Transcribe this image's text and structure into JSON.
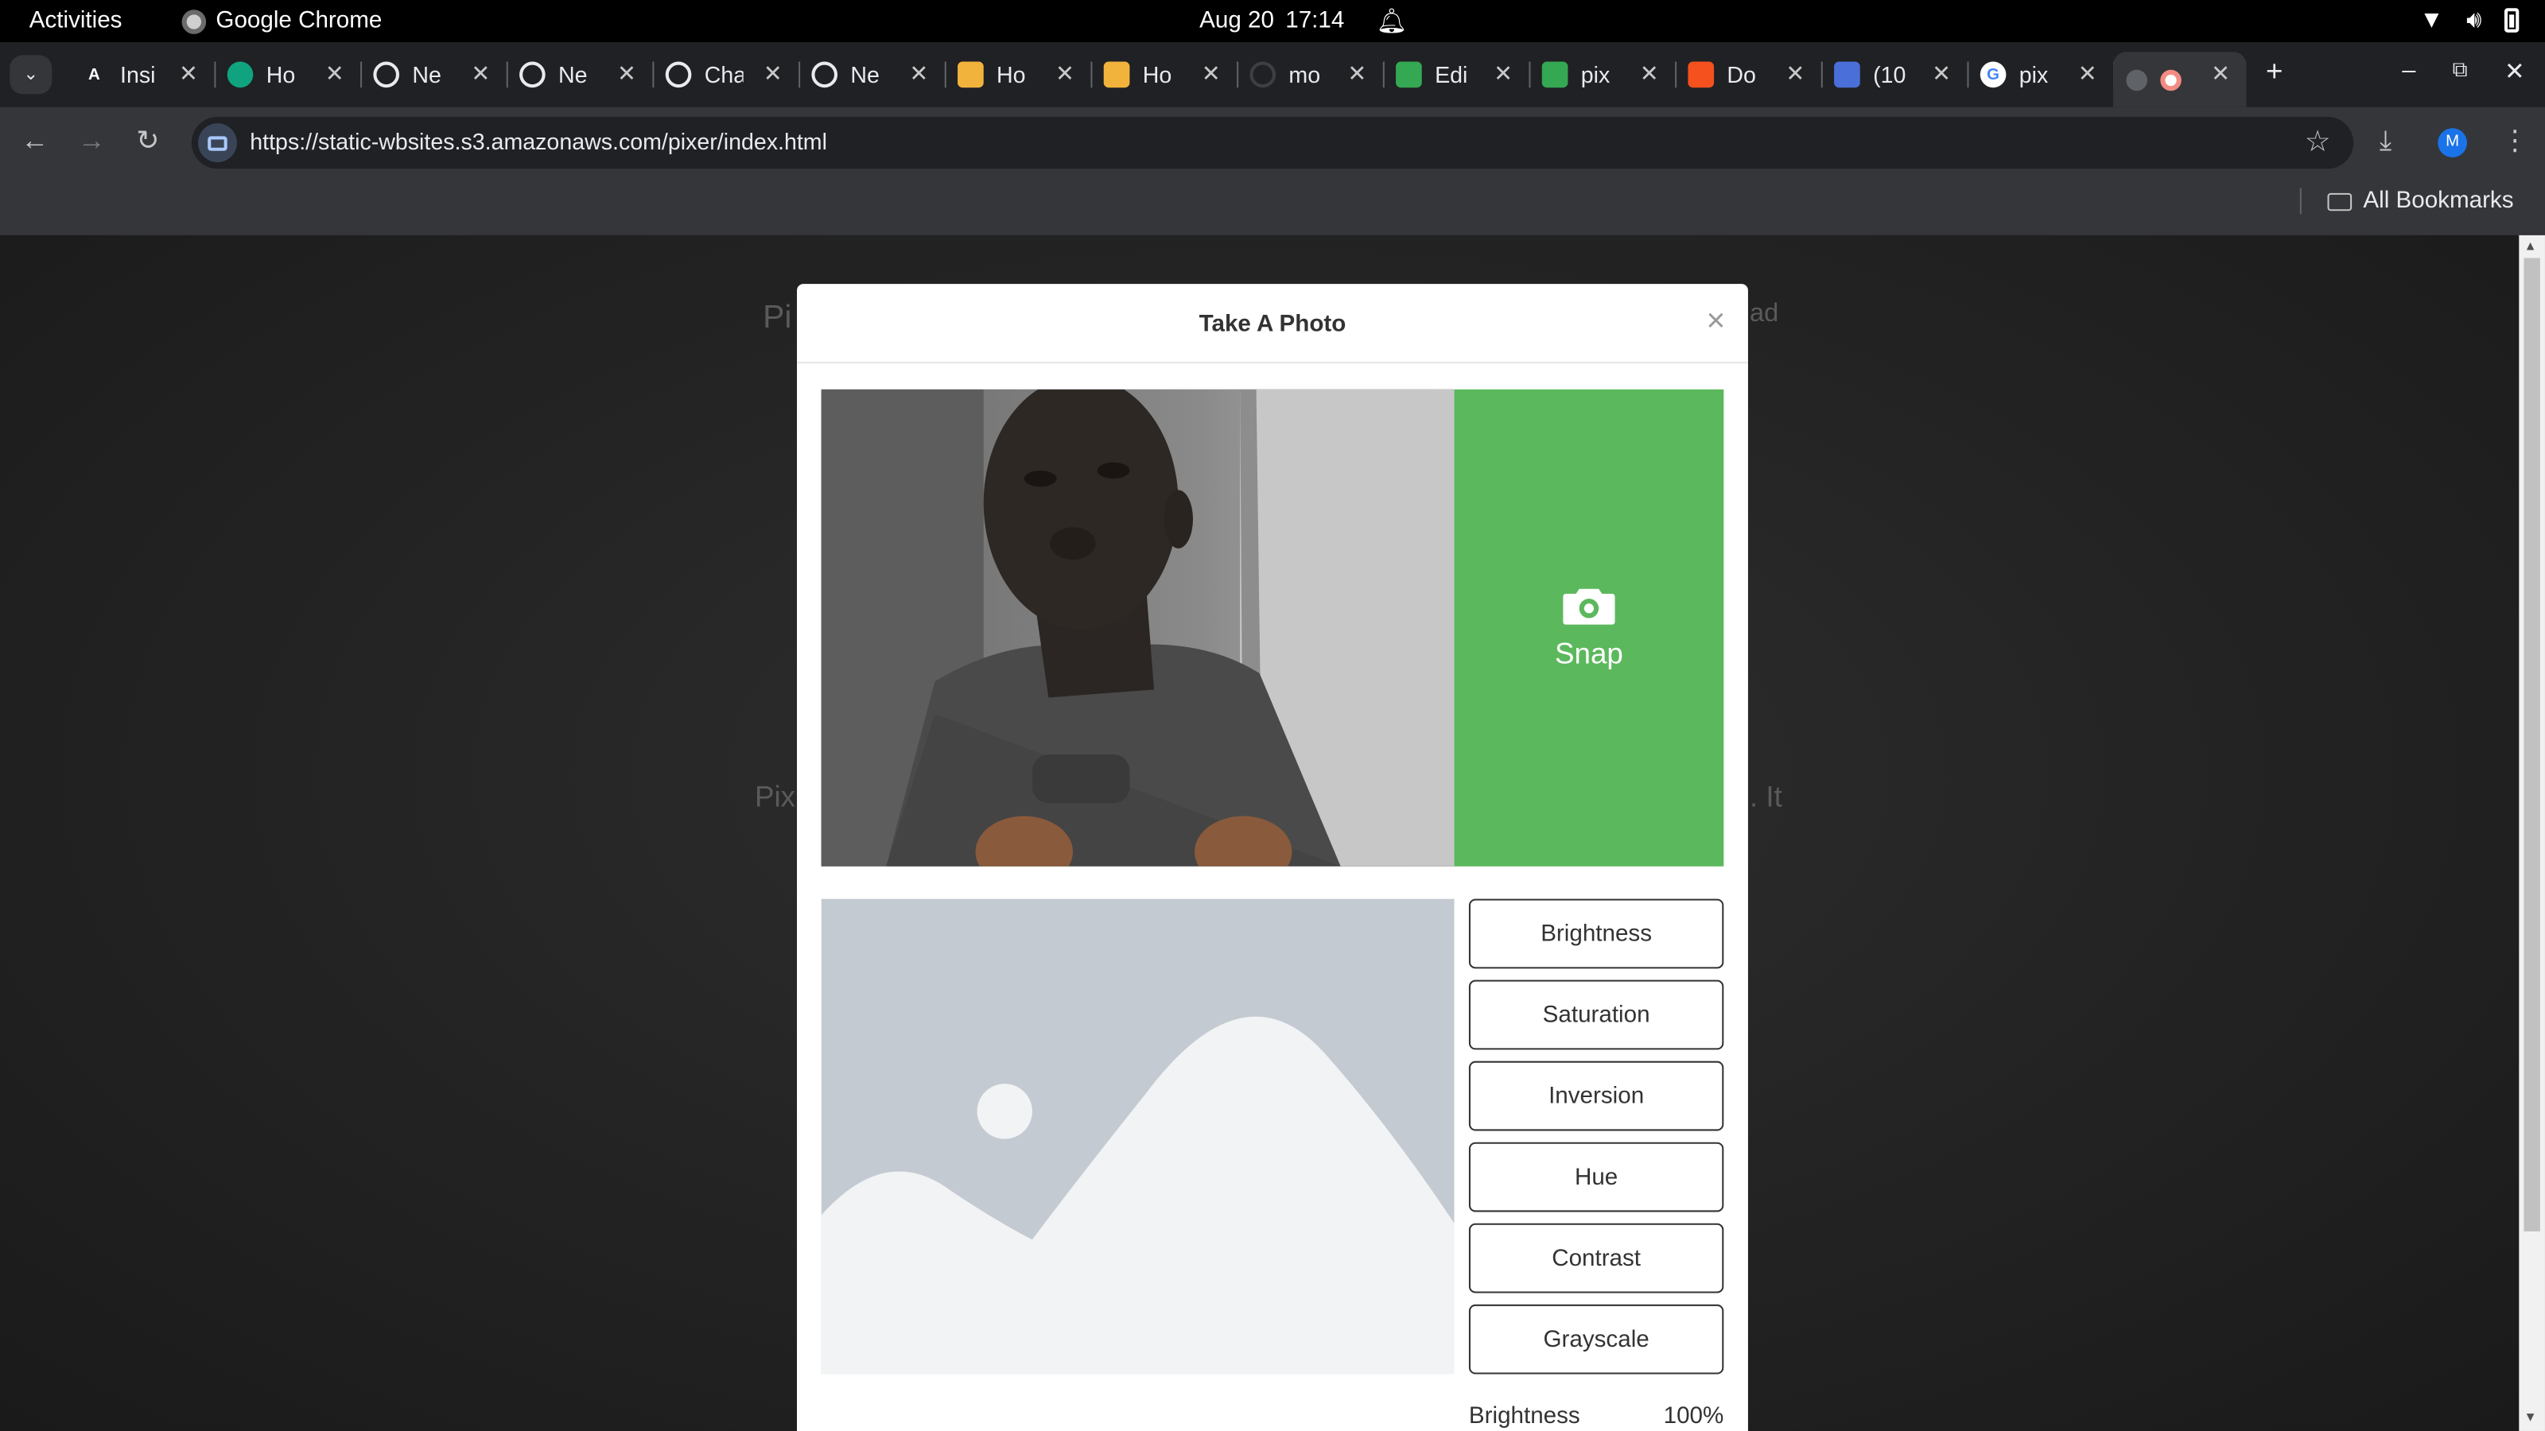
{
  "system_bar": {
    "activities": "Activities",
    "app_name": "Google Chrome",
    "date": "Aug 20",
    "time": "17:14"
  },
  "tabs": [
    {
      "title": "Insi",
      "icon": "anthropic-icon",
      "color": "#202124",
      "glyph": "A"
    },
    {
      "title": "Ho",
      "icon": "openai-green-icon",
      "color": "#10a37f",
      "glyph": ""
    },
    {
      "title": "Ne",
      "icon": "openai-icon",
      "color": "#5f6368",
      "glyph": ""
    },
    {
      "title": "Ne",
      "icon": "openai-icon",
      "color": "#5f6368",
      "glyph": ""
    },
    {
      "title": "Cha",
      "icon": "chatgpt-icon",
      "color": "#5f6368",
      "glyph": ""
    },
    {
      "title": "Ne",
      "icon": "openai-icon",
      "color": "#5f6368",
      "glyph": ""
    },
    {
      "title": "Ho",
      "icon": "box-icon",
      "color": "#f2b33d",
      "glyph": ""
    },
    {
      "title": "Ho",
      "icon": "box-icon",
      "color": "#f2b33d",
      "glyph": ""
    },
    {
      "title": "mo",
      "icon": "loading-icon",
      "color": "#202124",
      "glyph": ""
    },
    {
      "title": "Edi",
      "icon": "sheet-icon",
      "color": "#34a853",
      "glyph": ""
    },
    {
      "title": "pix",
      "icon": "sheet-icon",
      "color": "#34a853",
      "glyph": ""
    },
    {
      "title": "Do",
      "icon": "chart-app-icon",
      "color": "#f4511e",
      "glyph": ""
    },
    {
      "title": "(10",
      "icon": "flask-icon",
      "color": "#4a6fd8",
      "glyph": ""
    },
    {
      "title": "pix",
      "icon": "google-icon",
      "color": "#ffffff",
      "glyph": "G"
    }
  ],
  "address_bar": {
    "url": "https://static-wbsites.s3.amazonaws.com/pixer/index.html"
  },
  "bookmarks": {
    "all_bookmarks": "All Bookmarks",
    "profile_initial": "M"
  },
  "background_page": {
    "fragment_1": "Pi",
    "fragment_2": "ad",
    "fragment_3": "Pix",
    "fragment_4": ". It"
  },
  "modal": {
    "title": "Take A Photo",
    "close": "×",
    "snap_label": "Snap",
    "filters": [
      "Brightness",
      "Saturation",
      "Inversion",
      "Hue",
      "Contrast",
      "Grayscale"
    ],
    "readout_label": "Brightness",
    "readout_value": "100%"
  },
  "colors": {
    "snap_green": "#5cb85c",
    "modal_bg": "#ffffff",
    "page_bg": "#262626"
  }
}
